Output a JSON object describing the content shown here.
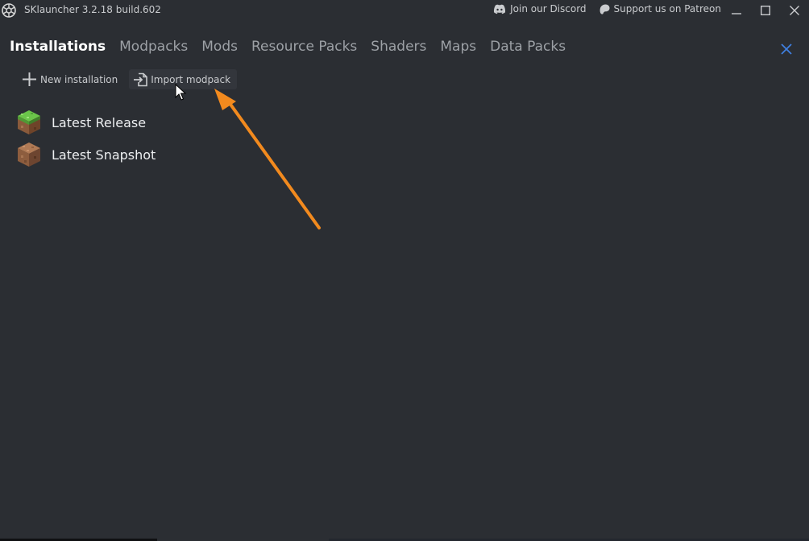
{
  "window": {
    "title": "SKlauncher 3.2.18 build.602",
    "app_icon": "sklauncher-logo-icon"
  },
  "top_links": {
    "discord": {
      "label": "Join our Discord",
      "icon": "discord-icon"
    },
    "patreon": {
      "label": "Support us on Patreon",
      "icon": "patreon-icon"
    }
  },
  "window_controls": [
    "minimize-icon",
    "maximize-icon",
    "close-icon"
  ],
  "tabs": [
    {
      "label": "Installations",
      "active": true
    },
    {
      "label": "Modpacks"
    },
    {
      "label": "Mods"
    },
    {
      "label": "Resource Packs"
    },
    {
      "label": "Shaders"
    },
    {
      "label": "Maps"
    },
    {
      "label": "Data Packs"
    }
  ],
  "toolbar": {
    "new_installation": {
      "label": "New installation",
      "icon": "plus-icon"
    },
    "import_modpack": {
      "label": "Import modpack",
      "icon": "import-icon"
    }
  },
  "installations": [
    {
      "label": "Latest Release",
      "icon": "grass-block-icon"
    },
    {
      "label": "Latest Snapshot",
      "icon": "dirt-block-icon"
    }
  ],
  "colors": {
    "background": "#2b2e33",
    "accent_close": "#3f7fe0",
    "arrow": "#f28a1e"
  }
}
